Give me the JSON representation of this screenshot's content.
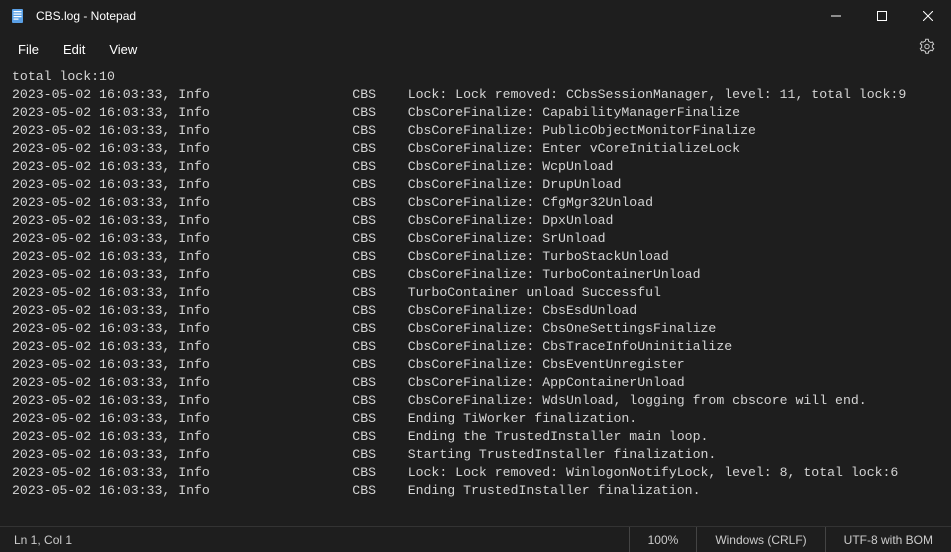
{
  "titlebar": {
    "title": "CBS.log - Notepad"
  },
  "menu": {
    "file": "File",
    "edit": "Edit",
    "view": "View"
  },
  "log_lines": [
    "total lock:10",
    "2023-05-02 16:03:33, Info                  CBS    Lock: Lock removed: CCbsSessionManager, level: 11, total lock:9",
    "2023-05-02 16:03:33, Info                  CBS    CbsCoreFinalize: CapabilityManagerFinalize",
    "2023-05-02 16:03:33, Info                  CBS    CbsCoreFinalize: PublicObjectMonitorFinalize",
    "2023-05-02 16:03:33, Info                  CBS    CbsCoreFinalize: Enter vCoreInitializeLock",
    "2023-05-02 16:03:33, Info                  CBS    CbsCoreFinalize: WcpUnload",
    "2023-05-02 16:03:33, Info                  CBS    CbsCoreFinalize: DrupUnload",
    "2023-05-02 16:03:33, Info                  CBS    CbsCoreFinalize: CfgMgr32Unload",
    "2023-05-02 16:03:33, Info                  CBS    CbsCoreFinalize: DpxUnload",
    "2023-05-02 16:03:33, Info                  CBS    CbsCoreFinalize: SrUnload",
    "2023-05-02 16:03:33, Info                  CBS    CbsCoreFinalize: TurboStackUnload",
    "2023-05-02 16:03:33, Info                  CBS    CbsCoreFinalize: TurboContainerUnload",
    "2023-05-02 16:03:33, Info                  CBS    TurboContainer unload Successful",
    "2023-05-02 16:03:33, Info                  CBS    CbsCoreFinalize: CbsEsdUnload",
    "2023-05-02 16:03:33, Info                  CBS    CbsCoreFinalize: CbsOneSettingsFinalize",
    "2023-05-02 16:03:33, Info                  CBS    CbsCoreFinalize: CbsTraceInfoUninitialize",
    "2023-05-02 16:03:33, Info                  CBS    CbsCoreFinalize: CbsEventUnregister",
    "2023-05-02 16:03:33, Info                  CBS    CbsCoreFinalize: AppContainerUnload",
    "2023-05-02 16:03:33, Info                  CBS    CbsCoreFinalize: WdsUnload, logging from cbscore will end.",
    "2023-05-02 16:03:33, Info                  CBS    Ending TiWorker finalization.",
    "2023-05-02 16:03:33, Info                  CBS    Ending the TrustedInstaller main loop.",
    "2023-05-02 16:03:33, Info                  CBS    Starting TrustedInstaller finalization.",
    "2023-05-02 16:03:33, Info                  CBS    Lock: Lock removed: WinlogonNotifyLock, level: 8, total lock:6",
    "2023-05-02 16:03:33, Info                  CBS    Ending TrustedInstaller finalization."
  ],
  "status": {
    "position": "Ln 1, Col 1",
    "zoom": "100%",
    "line_ending": "Windows (CRLF)",
    "encoding": "UTF-8 with BOM"
  }
}
